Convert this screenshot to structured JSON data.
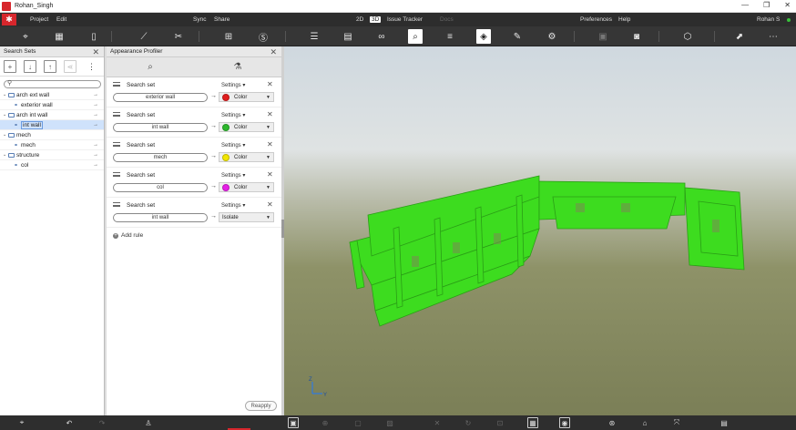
{
  "window": {
    "title": "Rohan_Singh",
    "controls": [
      "—",
      "❐",
      "✕"
    ]
  },
  "menu": {
    "items": [
      "Project",
      "Edit",
      "Sync",
      "Share",
      "2D",
      "3D",
      "Issue Tracker",
      "Docs",
      "Preferences",
      "Help"
    ],
    "user": "Rohan S",
    "active_mode": "3D"
  },
  "search_sets": {
    "title": "Search Sets",
    "search_placeholder": "",
    "tree": [
      {
        "type": "folder",
        "label": "arch ext wall"
      },
      {
        "type": "set",
        "label": "exterior wall"
      },
      {
        "type": "folder",
        "label": "arch int wall"
      },
      {
        "type": "set",
        "label": "int wall",
        "selected": true
      },
      {
        "type": "folder",
        "label": "mech"
      },
      {
        "type": "set",
        "label": "mech"
      },
      {
        "type": "folder",
        "label": "structure"
      },
      {
        "type": "set",
        "label": "col"
      }
    ]
  },
  "appearance_profiler": {
    "title": "Appearance Profiler",
    "rules": [
      {
        "label": "Search set",
        "settings": "Settings",
        "value": "exterior wall",
        "action": "Color",
        "color": "#e11d1d"
      },
      {
        "label": "Search set",
        "settings": "Settings",
        "value": "int wall",
        "action": "Color",
        "color": "#2db82d"
      },
      {
        "label": "Search set",
        "settings": "Settings",
        "value": "mech",
        "action": "Color",
        "color": "#f2e600"
      },
      {
        "label": "Search set",
        "settings": "Settings",
        "value": "col",
        "action": "Color",
        "color": "#e61ee6"
      },
      {
        "label": "Search set",
        "settings": "Settings",
        "value": "int wall",
        "action": "Isolate",
        "color": ""
      }
    ],
    "add_rule": "Add rule",
    "reapply": "Reapply"
  },
  "viewport": {
    "axis_z": "Z",
    "axis_y": "Y",
    "model_color": "#3ddc1f"
  }
}
